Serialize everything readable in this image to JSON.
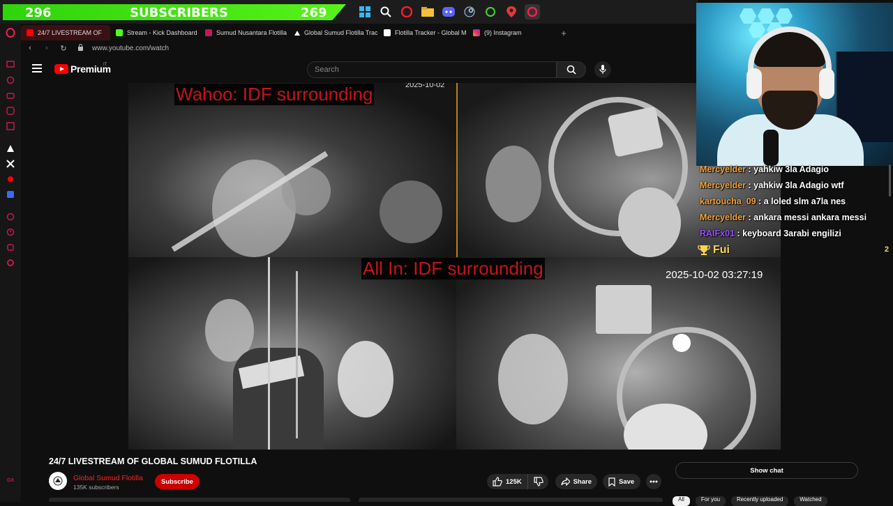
{
  "overlay": {
    "left_count": "296",
    "label": "SUBSCRIBERS",
    "right_count": "269",
    "taskbar_icons": [
      "windows-icon",
      "search-icon",
      "opera-icon",
      "folder-icon",
      "discord-icon",
      "steam-icon",
      "razer-icon",
      "maps-icon",
      "opera-gx-icon"
    ]
  },
  "tabs": [
    {
      "label": "24/7 LIVESTREAM OF",
      "favicon": "youtube-icon",
      "color": "#ff0000",
      "active": true
    },
    {
      "label": "Stream - Kick Dashboard",
      "favicon": "kick-icon",
      "color": "#53fc18",
      "active": false
    },
    {
      "label": "Sumud Nusantara Flotilla",
      "favicon": "flotilla-icon",
      "color": "#c2185b",
      "active": false
    },
    {
      "label": "Global Sumud Flotilla Trac",
      "favicon": "triangle-icon",
      "color": "#ffffff",
      "active": false
    },
    {
      "label": "Flotilla Tracker - Global M",
      "favicon": "tracker-icon",
      "color": "#ffffff",
      "active": false
    },
    {
      "label": "(9) Instagram",
      "favicon": "instagram-icon",
      "color": "#e1306c",
      "active": false
    }
  ],
  "address": {
    "url": "www.youtube.com/watch"
  },
  "youtube": {
    "logo_text": "Premium",
    "country": "IT",
    "search_placeholder": "Search"
  },
  "video": {
    "label_top": "Wahoo: IDF surrounding",
    "label_bottom": "All In: IDF surrounding",
    "timestamp": "2025-10-02 03:27:19",
    "timestamp_top": "2025-10-02"
  },
  "details": {
    "title": "24/7 LIVESTREAM OF GLOBAL SUMUD FLOTILLA",
    "channel": "Global Sumud Flotilla",
    "subscribers": "135K subscribers",
    "subscribe": "Subscribe",
    "likes": "125K",
    "share": "Share",
    "save": "Save",
    "show_chat": "Show chat",
    "chips": [
      "All",
      "For you",
      "Recently uploaded",
      "Watched"
    ]
  },
  "chat": {
    "messages": [
      {
        "user": "Mercyelder",
        "color": "#f4a33a",
        "text": "yahkiw 3la Adagio"
      },
      {
        "user": "Mercyelder",
        "color": "#f4a33a",
        "text": "yahkiw 3la Adagio wtf"
      },
      {
        "user": "kartoucha_09",
        "color": "#f4a33a",
        "text": "a loled slm a7la nes"
      },
      {
        "user": "Mercyelder",
        "color": "#f4a33a",
        "text": "ankara messi ankara messi"
      },
      {
        "user": "RAIFx01",
        "color": "#9b4dff",
        "text": "keyboard 3arabi engilizi"
      }
    ],
    "pinned_text": "Fui",
    "pinned_count": "2"
  },
  "sidebar": {
    "icons": [
      "opera-logo-icon",
      "twitch-icon",
      "wallet-icon",
      "controller-icon",
      "news-icon",
      "bag-icon",
      "ai-icon",
      "x-icon",
      "youtube-music-icon",
      "vpn-icon",
      "player-icon",
      "history-icon",
      "extensions-icon",
      "settings-icon",
      "gx-icon"
    ]
  }
}
